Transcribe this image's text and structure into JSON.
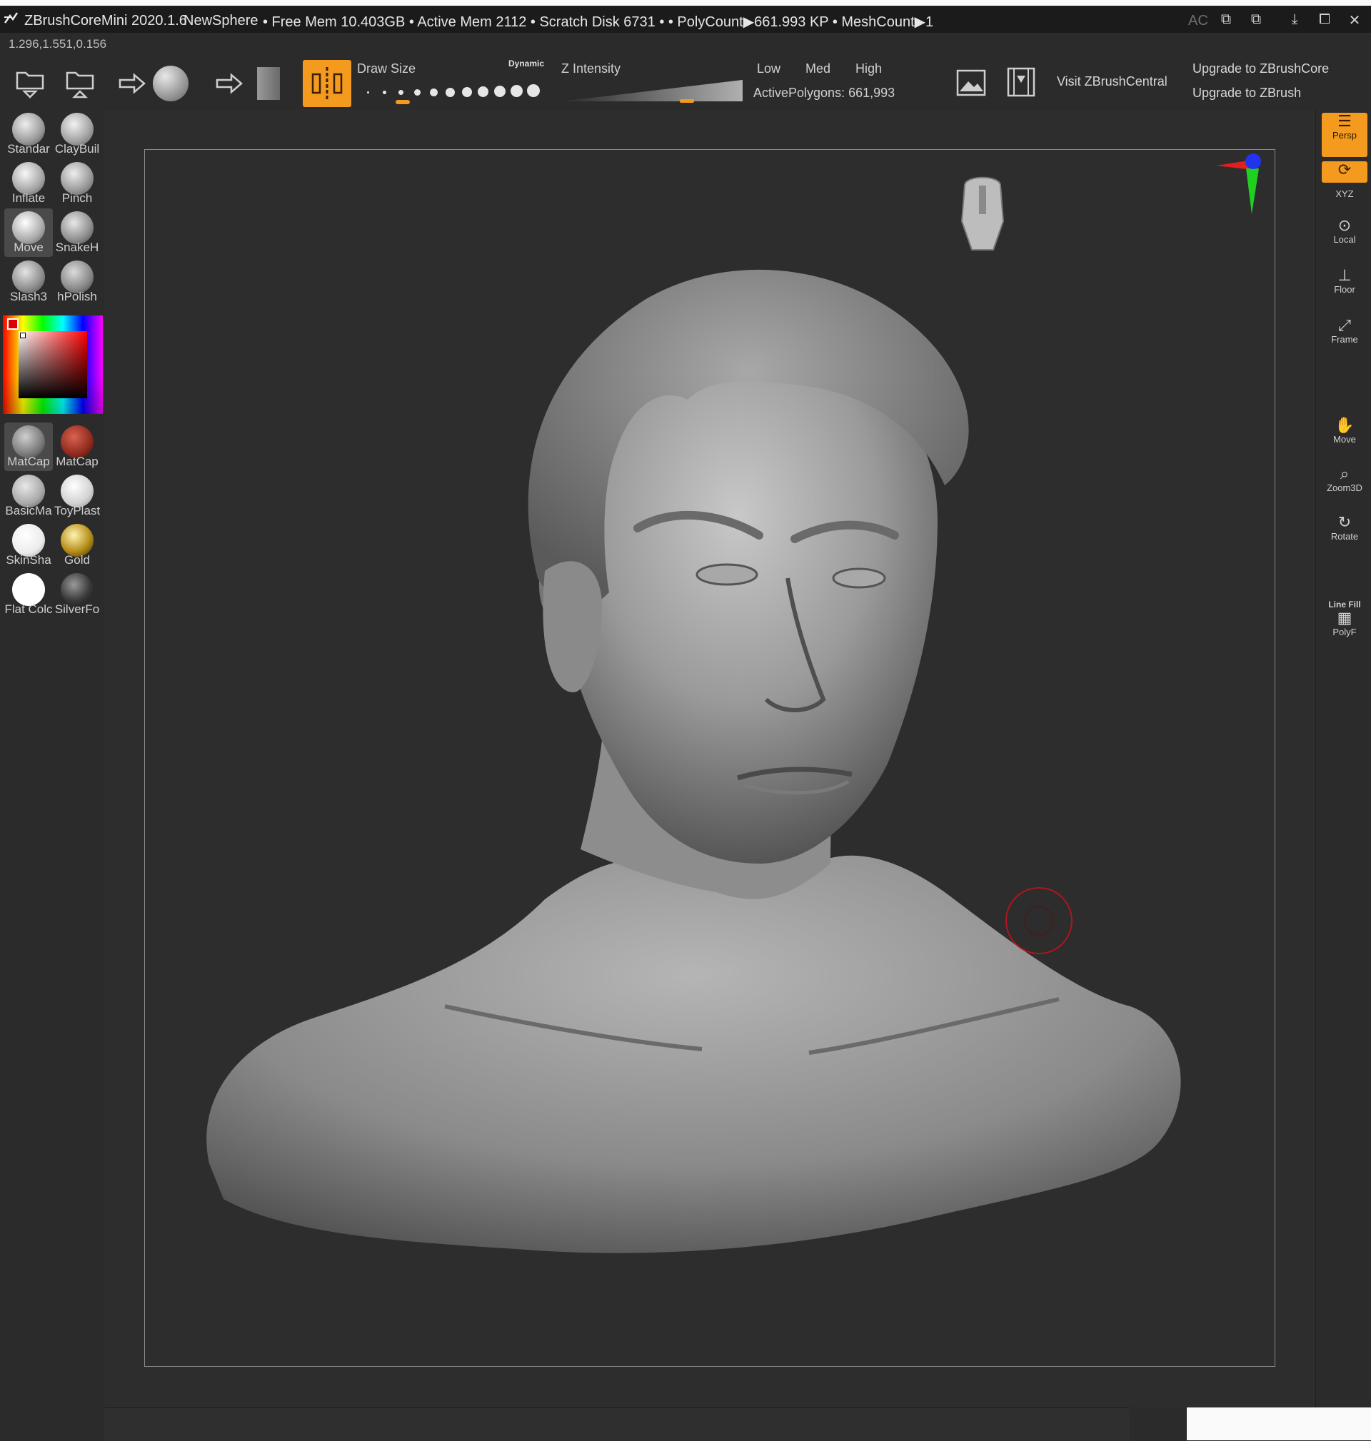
{
  "titlebar": {
    "app": "ZBrushCoreMini 2020.1.6",
    "document": "NewSphere",
    "stats": "• Free Mem 10.403GB • Active Mem 2112 • Scratch Disk 6731 •  • PolyCount▶661.993 KP  • MeshCount▶1",
    "ac": "AC"
  },
  "coords": "1.296,1.551,0.156",
  "toolbar": {
    "draw_size_label": "Draw Size",
    "dynamic_label": "Dynamic",
    "z_intensity_label": "Z Intensity",
    "low": "Low",
    "med": "Med",
    "high": "High",
    "active_polygons": "ActivePolygons: 661,993",
    "visit": "Visit ZBrushCentral",
    "upgrade_core": "Upgrade to ZBrushCore",
    "upgrade_zbrush": "Upgrade to ZBrush"
  },
  "brushes": [
    {
      "label": "Standar",
      "color": "#bdbdbd"
    },
    {
      "label": "ClayBuil",
      "color": "#c9c9c9"
    },
    {
      "label": "Inflate",
      "color": "#d2d2d2"
    },
    {
      "label": "Pinch",
      "color": "#c4c4c4"
    },
    {
      "label": "Move",
      "color": "#d8d8d8"
    },
    {
      "label": "SnakeH",
      "color": "#bdbdbd"
    },
    {
      "label": "Slash3",
      "color": "#bcbcbc"
    },
    {
      "label": "hPolish",
      "color": "#b4b4b4"
    }
  ],
  "materials": [
    {
      "label": "MatCap",
      "color": "#8a8a8a"
    },
    {
      "label": "MatCap",
      "color": "#8f2a1e"
    },
    {
      "label": "BasicMa",
      "color": "#a9a9a9"
    },
    {
      "label": "ToyPlast",
      "color": "#d2d2d2"
    },
    {
      "label": "SkinSha",
      "color": "#ececec"
    },
    {
      "label": "Gold",
      "color": "#b8901a"
    },
    {
      "label": "Flat Colc",
      "color": "#ffffff"
    },
    {
      "label": "SilverFo",
      "color": "#3a3a3a"
    }
  ],
  "rightshelf": {
    "persp": "Persp",
    "xyz": "XYZ",
    "local": "Local",
    "floor": "Floor",
    "frame": "Frame",
    "move": "Move",
    "zoom3d": "Zoom3D",
    "rotate": "Rotate",
    "linefill": "Line Fill",
    "polyf": "PolyF"
  },
  "colors": {
    "accent": "#f39a1f",
    "panel": "#2b2b2b",
    "cursor_ring": "#b3141b"
  }
}
